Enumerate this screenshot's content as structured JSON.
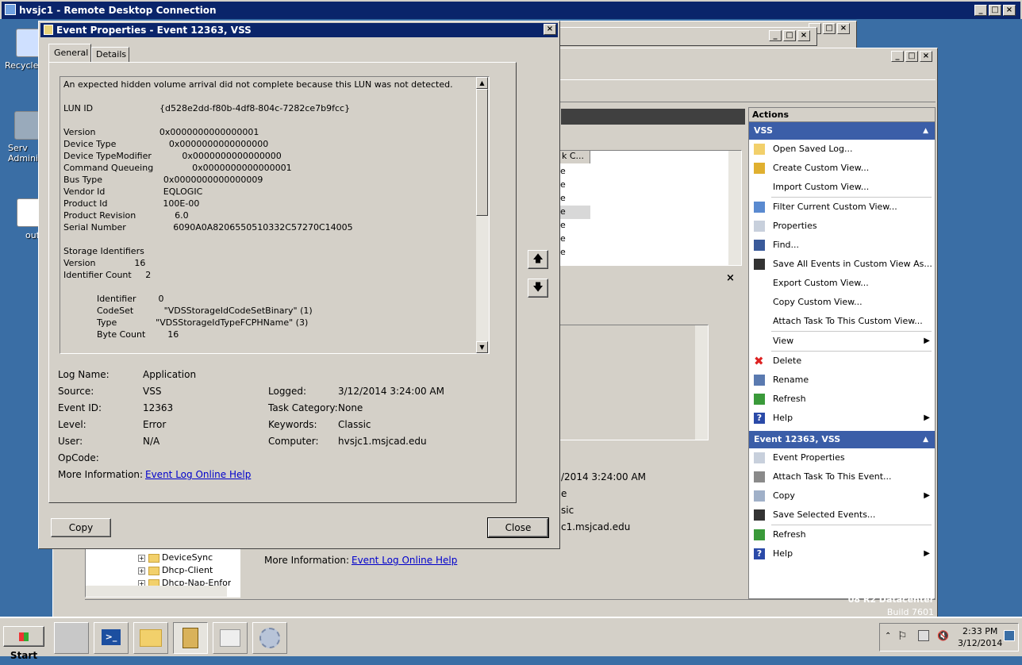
{
  "rdp": {
    "title": "hvsjc1 - Remote Desktop Connection"
  },
  "desktop": {
    "icons": [
      {
        "label": "Recycle"
      },
      {
        "label": "Serv Administ"
      },
      {
        "label": "out"
      }
    ]
  },
  "dialog": {
    "title": "Event Properties - Event 12363, VSS",
    "tabs": [
      "General",
      "Details"
    ],
    "message": [
      "An expected hidden volume arrival did not complete because this LUN was not detected.",
      "",
      "LUN ID                        {d528e2dd-f80b-4df8-804c-7282ce7b9fcc}",
      "",
      "Version                       0x0000000000000001",
      "Device Type                   0x0000000000000000",
      "Device TypeModifier           0x0000000000000000",
      "Command Queueing              0x0000000000000001",
      "Bus Type                      0x0000000000000009",
      "Vendor Id                     EQLOGIC",
      "Product Id                    100E-00",
      "Product Revision              6.0",
      "Serial Number                 6090A0A8206550510332C57270C14005",
      "",
      "Storage Identifiers",
      "Version              16",
      "Identifier Count     2",
      "",
      "            Identifier        0",
      "            CodeSet           \"VDSStorageIdCodeSetBinary\" (1)",
      "            Type              \"VDSStorageIdTypeFCPHName\" (3)",
      "            Byte Count        16"
    ],
    "fields": {
      "log_name_label": "Log Name:",
      "log_name": "Application",
      "source_label": "Source:",
      "source": "VSS",
      "logged_label": "Logged:",
      "logged": "3/12/2014 3:24:00 AM",
      "event_id_label": "Event ID:",
      "event_id": "12363",
      "task_category_label": "Task Category:",
      "task_category": "None",
      "level_label": "Level:",
      "level": "Error",
      "keywords_label": "Keywords:",
      "keywords": "Classic",
      "user_label": "User:",
      "user": "N/A",
      "computer_label": "Computer:",
      "computer": "hvsjc1.msjcad.edu",
      "opcode_label": "OpCode:",
      "opcode": "",
      "more_info_label": "More Information:",
      "more_info_link": "Event Log Online Help"
    },
    "copy_label": "Copy",
    "close_label": "Close"
  },
  "background": {
    "list_col": "k C...",
    "list_cells": [
      "e",
      "e",
      "e",
      "e",
      "e",
      "e",
      "e"
    ],
    "detail_logged": "/2014 3:24:00 AM",
    "detail_kw": "e",
    "detail_sic": "sic",
    "detail_comp": "c1.msjcad.edu",
    "more_info_label": "More Information:",
    "more_info_link": "Event Log Online Help",
    "tree": [
      "DeviceSync",
      "Dhcp-Client",
      "Dhcp-Nap-Enfor"
    ],
    "os_label": "08 R2 Datacenter",
    "build": "Build 7601"
  },
  "actions": {
    "header": "Actions",
    "sec1": "VSS",
    "items1": [
      {
        "label": "Open Saved Log...",
        "icon": "folder-open-icon"
      },
      {
        "label": "Create Custom View...",
        "icon": "funnel-icon"
      },
      {
        "label": "Import Custom View...",
        "icon": ""
      },
      {
        "label": "Filter Current Custom View...",
        "icon": "filter-icon"
      },
      {
        "label": "Properties",
        "icon": "properties-icon"
      },
      {
        "label": "Find...",
        "icon": "binoculars-icon"
      },
      {
        "label": "Save All Events in Custom View As...",
        "icon": "save-icon"
      },
      {
        "label": "Export Custom View...",
        "icon": ""
      },
      {
        "label": "Copy Custom View...",
        "icon": ""
      },
      {
        "label": "Attach Task To This Custom View...",
        "icon": ""
      },
      {
        "label": "View",
        "icon": "",
        "sub": true
      },
      {
        "label": "Delete",
        "icon": "delete-icon"
      },
      {
        "label": "Rename",
        "icon": "rename-icon"
      },
      {
        "label": "Refresh",
        "icon": "refresh-icon"
      },
      {
        "label": "Help",
        "icon": "help-icon",
        "sub": true
      }
    ],
    "sec2": "Event 12363, VSS",
    "items2": [
      {
        "label": "Event Properties",
        "icon": "properties-icon"
      },
      {
        "label": "Attach Task To This Event...",
        "icon": "task-icon"
      },
      {
        "label": "Copy",
        "icon": "copy-icon",
        "sub": true
      },
      {
        "label": "Save Selected Events...",
        "icon": "save-icon"
      },
      {
        "label": "Refresh",
        "icon": "refresh-icon"
      },
      {
        "label": "Help",
        "icon": "help-icon",
        "sub": true
      }
    ]
  },
  "taskbar": {
    "start": "Start",
    "time": "2:33 PM",
    "date": "3/12/2014"
  }
}
